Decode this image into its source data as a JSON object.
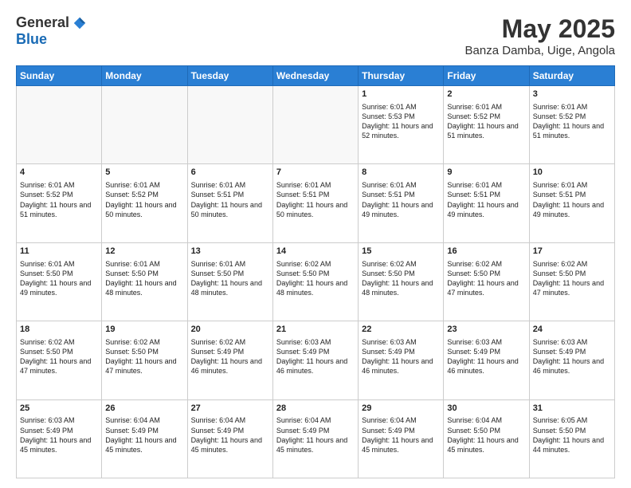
{
  "logo": {
    "general": "General",
    "blue": "Blue"
  },
  "header": {
    "title": "May 2025",
    "subtitle": "Banza Damba, Uige, Angola"
  },
  "weekdays": [
    "Sunday",
    "Monday",
    "Tuesday",
    "Wednesday",
    "Thursday",
    "Friday",
    "Saturday"
  ],
  "rows": [
    [
      {
        "day": "",
        "info": ""
      },
      {
        "day": "",
        "info": ""
      },
      {
        "day": "",
        "info": ""
      },
      {
        "day": "",
        "info": ""
      },
      {
        "day": "1",
        "sunrise": "6:01 AM",
        "sunset": "5:53 PM",
        "daylight": "11 hours and 52 minutes."
      },
      {
        "day": "2",
        "sunrise": "6:01 AM",
        "sunset": "5:52 PM",
        "daylight": "11 hours and 51 minutes."
      },
      {
        "day": "3",
        "sunrise": "6:01 AM",
        "sunset": "5:52 PM",
        "daylight": "11 hours and 51 minutes."
      }
    ],
    [
      {
        "day": "4",
        "sunrise": "6:01 AM",
        "sunset": "5:52 PM",
        "daylight": "11 hours and 51 minutes."
      },
      {
        "day": "5",
        "sunrise": "6:01 AM",
        "sunset": "5:52 PM",
        "daylight": "11 hours and 50 minutes."
      },
      {
        "day": "6",
        "sunrise": "6:01 AM",
        "sunset": "5:51 PM",
        "daylight": "11 hours and 50 minutes."
      },
      {
        "day": "7",
        "sunrise": "6:01 AM",
        "sunset": "5:51 PM",
        "daylight": "11 hours and 50 minutes."
      },
      {
        "day": "8",
        "sunrise": "6:01 AM",
        "sunset": "5:51 PM",
        "daylight": "11 hours and 49 minutes."
      },
      {
        "day": "9",
        "sunrise": "6:01 AM",
        "sunset": "5:51 PM",
        "daylight": "11 hours and 49 minutes."
      },
      {
        "day": "10",
        "sunrise": "6:01 AM",
        "sunset": "5:51 PM",
        "daylight": "11 hours and 49 minutes."
      }
    ],
    [
      {
        "day": "11",
        "sunrise": "6:01 AM",
        "sunset": "5:50 PM",
        "daylight": "11 hours and 49 minutes."
      },
      {
        "day": "12",
        "sunrise": "6:01 AM",
        "sunset": "5:50 PM",
        "daylight": "11 hours and 48 minutes."
      },
      {
        "day": "13",
        "sunrise": "6:01 AM",
        "sunset": "5:50 PM",
        "daylight": "11 hours and 48 minutes."
      },
      {
        "day": "14",
        "sunrise": "6:02 AM",
        "sunset": "5:50 PM",
        "daylight": "11 hours and 48 minutes."
      },
      {
        "day": "15",
        "sunrise": "6:02 AM",
        "sunset": "5:50 PM",
        "daylight": "11 hours and 48 minutes."
      },
      {
        "day": "16",
        "sunrise": "6:02 AM",
        "sunset": "5:50 PM",
        "daylight": "11 hours and 47 minutes."
      },
      {
        "day": "17",
        "sunrise": "6:02 AM",
        "sunset": "5:50 PM",
        "daylight": "11 hours and 47 minutes."
      }
    ],
    [
      {
        "day": "18",
        "sunrise": "6:02 AM",
        "sunset": "5:50 PM",
        "daylight": "11 hours and 47 minutes."
      },
      {
        "day": "19",
        "sunrise": "6:02 AM",
        "sunset": "5:50 PM",
        "daylight": "11 hours and 47 minutes."
      },
      {
        "day": "20",
        "sunrise": "6:02 AM",
        "sunset": "5:49 PM",
        "daylight": "11 hours and 46 minutes."
      },
      {
        "day": "21",
        "sunrise": "6:03 AM",
        "sunset": "5:49 PM",
        "daylight": "11 hours and 46 minutes."
      },
      {
        "day": "22",
        "sunrise": "6:03 AM",
        "sunset": "5:49 PM",
        "daylight": "11 hours and 46 minutes."
      },
      {
        "day": "23",
        "sunrise": "6:03 AM",
        "sunset": "5:49 PM",
        "daylight": "11 hours and 46 minutes."
      },
      {
        "day": "24",
        "sunrise": "6:03 AM",
        "sunset": "5:49 PM",
        "daylight": "11 hours and 46 minutes."
      }
    ],
    [
      {
        "day": "25",
        "sunrise": "6:03 AM",
        "sunset": "5:49 PM",
        "daylight": "11 hours and 45 minutes."
      },
      {
        "day": "26",
        "sunrise": "6:04 AM",
        "sunset": "5:49 PM",
        "daylight": "11 hours and 45 minutes."
      },
      {
        "day": "27",
        "sunrise": "6:04 AM",
        "sunset": "5:49 PM",
        "daylight": "11 hours and 45 minutes."
      },
      {
        "day": "28",
        "sunrise": "6:04 AM",
        "sunset": "5:49 PM",
        "daylight": "11 hours and 45 minutes."
      },
      {
        "day": "29",
        "sunrise": "6:04 AM",
        "sunset": "5:49 PM",
        "daylight": "11 hours and 45 minutes."
      },
      {
        "day": "30",
        "sunrise": "6:04 AM",
        "sunset": "5:50 PM",
        "daylight": "11 hours and 45 minutes."
      },
      {
        "day": "31",
        "sunrise": "6:05 AM",
        "sunset": "5:50 PM",
        "daylight": "11 hours and 44 minutes."
      }
    ]
  ]
}
